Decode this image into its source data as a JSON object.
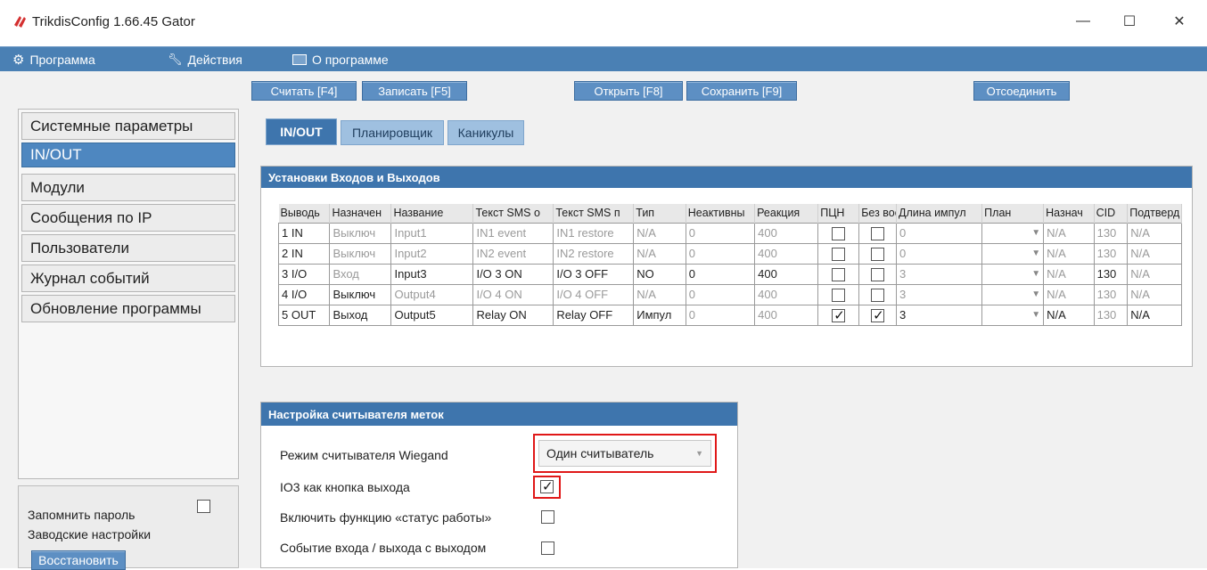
{
  "window": {
    "title": "TrikdisConfig 1.66.45   Gator",
    "controls": {
      "minimize": "—",
      "maximize": "☐",
      "close": "✕"
    }
  },
  "menu": {
    "program": "Программа",
    "actions": "Действия",
    "about": "О программе"
  },
  "toolbar": {
    "read": "Считать [F4]",
    "write": "Записать [F5]",
    "open": "Открыть [F8]",
    "save": "Сохранить [F9]",
    "disconnect": "Отсоединить"
  },
  "sidebar": {
    "items": [
      {
        "label": "Системные параметры"
      },
      {
        "label": "IN/OUT"
      },
      {
        "label": "Модули"
      },
      {
        "label": "Сообщения по IP"
      },
      {
        "label": "Пользователи"
      },
      {
        "label": "Журнал событий"
      },
      {
        "label": "Обновление программы"
      }
    ],
    "active": "IN/OUT",
    "remember_password": "Запомнить пароль",
    "factory_settings": "Заводские настройки",
    "restore": "Восстановить"
  },
  "tabs": [
    {
      "label": "IN/OUT"
    },
    {
      "label": "Планировщик"
    },
    {
      "label": "Каникулы"
    }
  ],
  "io_panel": {
    "title": "Установки Входов и Выходов",
    "columns": [
      "Выводь",
      "Назначен",
      "Название",
      "Текст SMS о",
      "Текст SMS п",
      "Тип",
      "Неактивны",
      "Реакция",
      "ПЦН",
      "Без вос",
      "Длина импул",
      "План",
      "Назнач",
      "CID",
      "Подтверд"
    ],
    "rows": [
      {
        "out": "1 IN",
        "assign": "Выключ",
        "name": "Input1",
        "sms_on": "IN1 event",
        "sms_off": "IN1 restore",
        "type": "N/A",
        "inactive": "0",
        "reaction": "400",
        "pcn": false,
        "norestore": false,
        "pulse": "0",
        "plan": "",
        "assign2": "N/A",
        "cid": "130",
        "confirm": "N/A"
      },
      {
        "out": "2 IN",
        "assign": "Выключ",
        "name": "Input2",
        "sms_on": "IN2 event",
        "sms_off": "IN2 restore",
        "type": "N/A",
        "inactive": "0",
        "reaction": "400",
        "pcn": false,
        "norestore": false,
        "pulse": "0",
        "plan": "",
        "assign2": "N/A",
        "cid": "130",
        "confirm": "N/A"
      },
      {
        "out": "3 I/O",
        "assign": "Вход",
        "name": "Input3",
        "sms_on": "I/O 3 ON",
        "sms_off": "I/O 3 OFF",
        "type": "NO",
        "inactive": "0",
        "reaction": "400",
        "pcn": false,
        "norestore": false,
        "pulse": "3",
        "plan": "",
        "assign2": "N/A",
        "cid": "130",
        "confirm": "N/A"
      },
      {
        "out": "4 I/O",
        "assign": "Выключ",
        "name": "Output4",
        "sms_on": "I/O 4 ON",
        "sms_off": "I/O 4 OFF",
        "type": "N/A",
        "inactive": "0",
        "reaction": "400",
        "pcn": false,
        "norestore": false,
        "pulse": "3",
        "plan": "",
        "assign2": "N/A",
        "cid": "130",
        "confirm": "N/A"
      },
      {
        "out": "5 OUT",
        "assign": "Выход",
        "name": "Output5",
        "sms_on": "Relay ON",
        "sms_off": "Relay OFF",
        "type": "Импул",
        "inactive": "0",
        "reaction": "400",
        "pcn": true,
        "norestore": true,
        "pulse": "3",
        "plan": "",
        "assign2": "N/A",
        "cid": "130",
        "confirm": "N/A"
      }
    ]
  },
  "reader_panel": {
    "title": "Настройка считывателя меток",
    "wiegand_mode_label": "Режим считывателя Wiegand",
    "wiegand_mode_value": "Один считыватель",
    "io3_exit_label": "IO3 как кнопка выхода",
    "io3_exit_checked": true,
    "work_status_label": "Включить функцию «статус работы»",
    "work_status_checked": false,
    "entry_exit_label": "Событие входа / выхода с выходом",
    "entry_exit_checked": false
  },
  "colors": {
    "menubar": "#4a80b4",
    "accent": "#3e75ad",
    "highlight": "#e01818"
  }
}
